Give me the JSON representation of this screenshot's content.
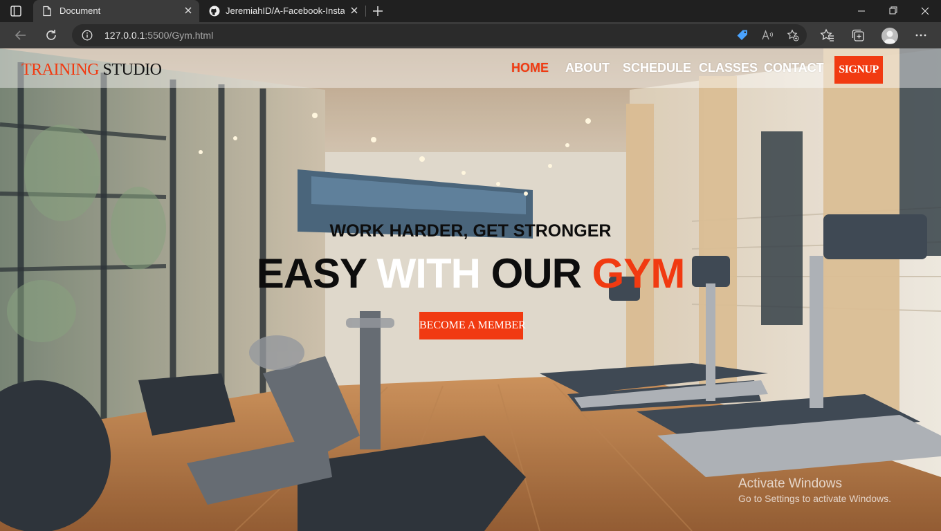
{
  "browser": {
    "tabs": [
      {
        "title": "Document",
        "icon": "document-icon",
        "active": true
      },
      {
        "title": "JeremiahID/A-Facebook-Instagram",
        "icon": "github-icon",
        "active": false
      }
    ],
    "address": {
      "host": "127.0.0.1",
      "path": ":5500/Gym.html"
    },
    "theme": {
      "frame": "#202020",
      "toolbar": "#3b3b3b",
      "omnibox": "#2b2b2b"
    }
  },
  "site": {
    "logo": {
      "part1": "TRAINING",
      "part2": "STUDIO"
    },
    "nav": [
      {
        "label": "HOME",
        "active": true
      },
      {
        "label": "ABOUT",
        "active": false
      },
      {
        "label": "SCHEDULE",
        "active": false
      },
      {
        "label": "CLASSES",
        "active": false
      },
      {
        "label": "CONTACT",
        "active": false
      }
    ],
    "signup_label": "SIGNUP",
    "hero": {
      "subtitle": "WORK HARDER, GET STRONGER",
      "headline": [
        "EASY",
        "WITH",
        "OUR",
        "GYM"
      ],
      "cta_label": "BECOME A MEMBER"
    },
    "accent_color": "#f13a11"
  },
  "os_watermark": {
    "title": "Activate Windows",
    "subtitle": "Go to Settings to activate Windows."
  }
}
